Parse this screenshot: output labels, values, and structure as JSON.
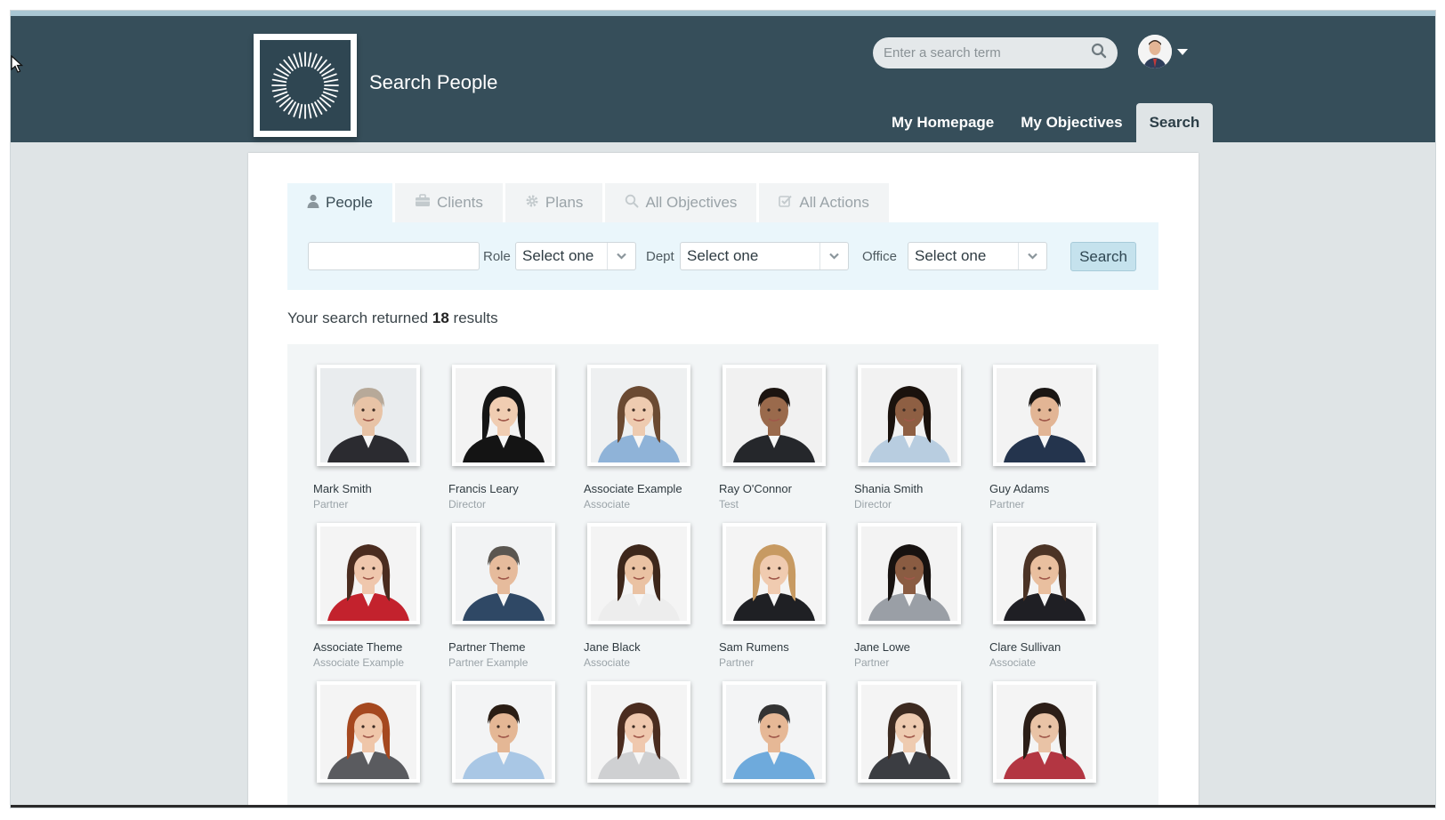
{
  "header": {
    "page_title": "Search People",
    "search_placeholder": "Enter a search term",
    "nav": [
      {
        "label": "My Homepage",
        "active": false
      },
      {
        "label": "My Objectives",
        "active": false
      },
      {
        "label": "Search",
        "active": true
      }
    ]
  },
  "tabs": [
    {
      "label": "People",
      "icon": "person-icon",
      "active": true
    },
    {
      "label": "Clients",
      "icon": "briefcase-icon",
      "active": false
    },
    {
      "label": "Plans",
      "icon": "gear-icon",
      "active": false
    },
    {
      "label": "All Objectives",
      "icon": "search-icon",
      "active": false
    },
    {
      "label": "All Actions",
      "icon": "checkbox-icon",
      "active": false
    }
  ],
  "filters": {
    "keyword_value": "",
    "role_label": "Role",
    "role_value": "Select one",
    "dept_label": "Dept",
    "dept_value": "Select one",
    "office_label": "Office",
    "office_value": "Select one",
    "search_button": "Search"
  },
  "results": {
    "prefix": "Your search returned",
    "count": "18",
    "suffix": "results"
  },
  "people": [
    {
      "name": "Mark Smith",
      "role": "Partner",
      "bg": "#e9ecee",
      "skin": "#e8c3a6",
      "hair": "#b7a999",
      "suit": "#2b2b30"
    },
    {
      "name": "Francis Leary",
      "role": "Director",
      "bg": "#f3f3f3",
      "skin": "#f0cdb2",
      "hair": "#151515",
      "suit": "#141414"
    },
    {
      "name": "Associate Example",
      "role": "Associate",
      "bg": "#eef0f1",
      "skin": "#eecbb0",
      "hair": "#6b4a32",
      "suit": "#8fb3d8"
    },
    {
      "name": "Ray O'Connor",
      "role": "Test",
      "bg": "#f1f1f1",
      "skin": "#9a6a4c",
      "hair": "#1c1410",
      "suit": "#25272b"
    },
    {
      "name": "Shania Smith",
      "role": "Director",
      "bg": "#f2f2f2",
      "skin": "#8e5f43",
      "hair": "#1a120d",
      "suit": "#b8cde0"
    },
    {
      "name": "Guy Adams",
      "role": "Partner",
      "bg": "#f3f3f3",
      "skin": "#e2b595",
      "hair": "#1a1614",
      "suit": "#24344d"
    },
    {
      "name": "Associate Theme",
      "role": "Associate Example",
      "bg": "#f4f4f4",
      "skin": "#efc7ad",
      "hair": "#4a2c1f",
      "suit": "#c3222d"
    },
    {
      "name": "Partner Theme",
      "role": "Partner Example",
      "bg": "#f2f3f4",
      "skin": "#e6bb9c",
      "hair": "#5b5650",
      "suit": "#2f4865"
    },
    {
      "name": "Jane Black",
      "role": "Associate",
      "bg": "#f4f4f4",
      "skin": "#eac2a3",
      "hair": "#3d271b",
      "suit": "#ededed"
    },
    {
      "name": "Sam Rumens",
      "role": "Partner",
      "bg": "#f4f4f4",
      "skin": "#f0cbb0",
      "hair": "#c79a62",
      "suit": "#1f2024"
    },
    {
      "name": "Jane Lowe",
      "role": "Partner",
      "bg": "#f3f3f3",
      "skin": "#8a5c42",
      "hair": "#171210",
      "suit": "#9a9fa6"
    },
    {
      "name": "Clare Sullivan",
      "role": "Associate",
      "bg": "#f4f4f4",
      "skin": "#e9bf9f",
      "hair": "#4b3325",
      "suit": "#1f1f24"
    },
    {
      "name": "",
      "role": "",
      "bg": "#f4f4f4",
      "skin": "#efc6a9",
      "hair": "#a5481f",
      "suit": "#5a5b5f"
    },
    {
      "name": "",
      "role": "",
      "bg": "#f3f4f5",
      "skin": "#e4b795",
      "hair": "#2a1d14",
      "suit": "#a9c7e5"
    },
    {
      "name": "",
      "role": "",
      "bg": "#f4f4f4",
      "skin": "#efc8ae",
      "hair": "#4a2c1f",
      "suit": "#cfd0d2"
    },
    {
      "name": "",
      "role": "",
      "bg": "#f3f4f5",
      "skin": "#e6b896",
      "hair": "#333",
      "suit": "#6eaadc"
    },
    {
      "name": "",
      "role": "",
      "bg": "#f4f4f4",
      "skin": "#eecbb0",
      "hair": "#3c2a20",
      "suit": "#3b3d42"
    },
    {
      "name": "",
      "role": "",
      "bg": "#f4f4f4",
      "skin": "#e9c3a6",
      "hair": "#2c1e17",
      "suit": "#b33642"
    }
  ]
}
